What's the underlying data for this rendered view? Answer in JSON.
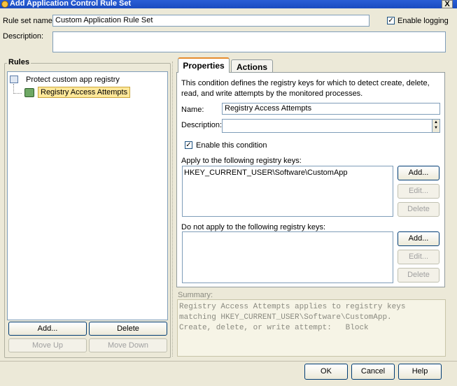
{
  "window": {
    "title": "Add Application Control Rule Set",
    "close_label": "X"
  },
  "rule_set": {
    "name_label": "Rule set name:",
    "name_value": "Custom Application Rule Set",
    "description_label": "Description:",
    "description_value": "",
    "enable_logging_label": "Enable logging",
    "enable_logging_checked": true
  },
  "rules": {
    "group_title": "Rules",
    "tree": [
      {
        "label": "Protect custom app registry",
        "icon": "registry-rule-icon"
      },
      {
        "label": "Registry Access Attempts",
        "icon": "registry-condition-icon",
        "selected": true
      }
    ],
    "buttons": {
      "add": "Add...",
      "delete": "Delete",
      "move_up": "Move Up",
      "move_down": "Move Down"
    }
  },
  "tabs": {
    "properties": "Properties",
    "actions": "Actions",
    "active": "properties"
  },
  "properties": {
    "intro": "This condition defines the registry keys for which to detect create, delete, read, and write attempts by the monitored processes.",
    "name_label": "Name:",
    "name_value": "Registry Access Attempts",
    "description_label": "Description:",
    "description_value": "",
    "enable_condition_label": "Enable this condition",
    "enable_condition_checked": true,
    "apply_label": "Apply to the following registry keys:",
    "apply_keys": [
      "HKEY_CURRENT_USER\\Software\\CustomApp"
    ],
    "not_apply_label": "Do not apply to the following registry keys:",
    "not_apply_keys": [],
    "buttons": {
      "add": "Add...",
      "edit": "Edit...",
      "delete": "Delete"
    }
  },
  "summary": {
    "label": "Summary:",
    "lines": [
      "Registry Access Attempts applies to registry keys",
      "matching HKEY_CURRENT_USER\\Software\\CustomApp.",
      "Create, delete, or write attempt:   Block"
    ]
  },
  "footer": {
    "ok": "OK",
    "cancel": "Cancel",
    "help": "Help"
  }
}
